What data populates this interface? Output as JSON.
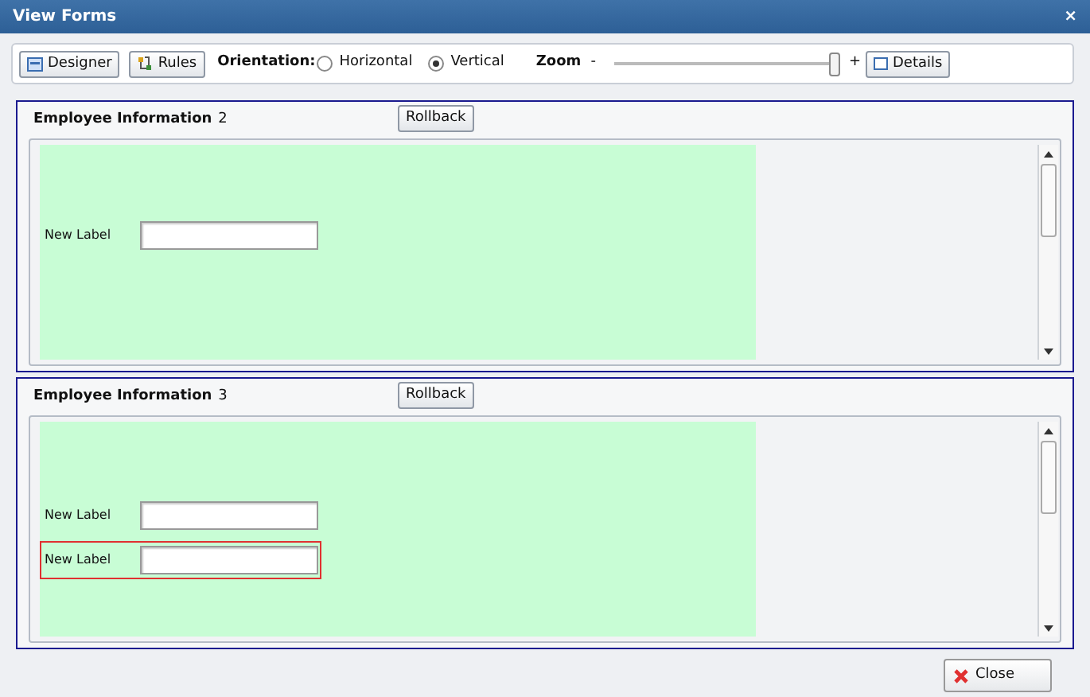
{
  "window": {
    "title": "View Forms",
    "close": "×"
  },
  "toolbar": {
    "buttons": [
      {
        "kind": "designer",
        "label": "Designer"
      },
      {
        "kind": "rules",
        "label": "Rules"
      }
    ],
    "orientation_label": "Orientation:",
    "orientations": [
      {
        "label": "Horizontal",
        "selected": false
      },
      {
        "label": "Vertical",
        "selected": true
      }
    ],
    "zoom_label": "Zoom",
    "zoom_minus": "-",
    "zoom": {
      "level": 0.97
    },
    "zoom_plus": "+",
    "details": "Details"
  },
  "forms": [
    {
      "title": "Employee Information",
      "number": "2",
      "rollback": "Rollback",
      "fields": [
        {
          "label": "New Label",
          "selected": false
        }
      ]
    },
    {
      "title": "Employee Information",
      "number": "3",
      "rollback": "Rollback",
      "fields": [
        {
          "label": "New Label",
          "selected": false
        },
        {
          "label": "New Label",
          "selected": true
        }
      ]
    }
  ],
  "close_button": "Close"
}
